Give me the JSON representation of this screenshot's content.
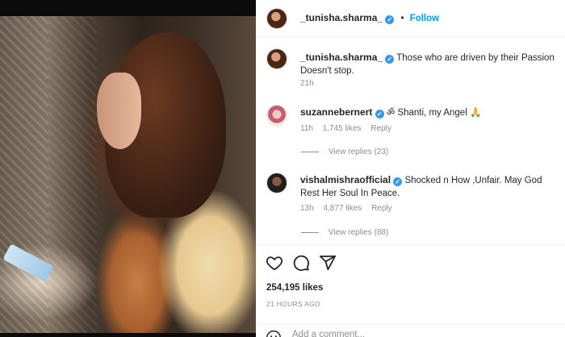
{
  "post": {
    "username": "_tunisha.sharma_",
    "follow_label": "Follow",
    "dot": "•",
    "caption": "Those who are driven by their Passion Doesn't stop.",
    "caption_time": "21h"
  },
  "comments": [
    {
      "username": "suzannebernert",
      "text": "ॐ Shanti, my Angel 🙏",
      "time": "11h",
      "likes": "1,745 likes",
      "reply_label": "Reply",
      "view_replies": "View replies (23)"
    },
    {
      "username": "vishalmishraofficial",
      "text": "Shocked n How ,Unfair. May God Rest Her Soul In Peace.",
      "time": "13h",
      "likes": "4,877 likes",
      "reply_label": "Reply",
      "view_replies": "View replies (88)"
    }
  ],
  "actions": {
    "icons": [
      "heart-icon",
      "comment-icon",
      "share-icon"
    ]
  },
  "stats": {
    "likes": "254,195 likes",
    "posted": "21 HOURS AGO"
  },
  "add_comment": {
    "placeholder": "Add a comment..."
  },
  "colors": {
    "accent": "#0095f6",
    "verified": "#3897f0",
    "muted": "#8e8e8e",
    "text": "#262626"
  }
}
